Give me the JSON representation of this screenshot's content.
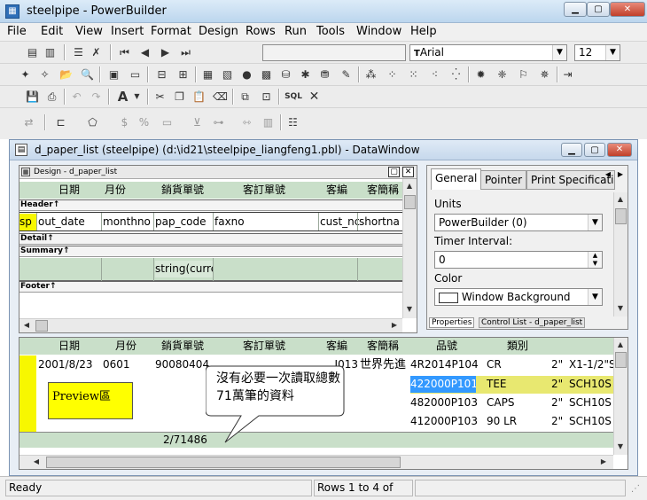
{
  "app": {
    "title": "steelpipe - PowerBuilder",
    "icon": "powerbuilder-app-icon"
  },
  "menu": [
    "File",
    "Edit",
    "View",
    "Insert",
    "Format",
    "Design",
    "Rows",
    "Run",
    "Tools",
    "Window",
    "Help"
  ],
  "font_toolbar": {
    "font": "Arial",
    "size": "12"
  },
  "window": {
    "title": "d_paper_list  (steelpipe) (d:\\id21\\steelpipe_liangfeng1.pbl) - DataWindow"
  },
  "design": {
    "title": "Design - d_paper_list",
    "headers": [
      "日期",
      "月份",
      "銷貨單號",
      "客訂單號",
      "客編",
      "客簡稱"
    ],
    "bands": {
      "header": "Header↑",
      "detail": "Detail↑",
      "summary": "Summary↑",
      "footer": "Footer↑"
    },
    "detail_fields": [
      "sp",
      "out_date",
      "monthno",
      "pap_code",
      "faxno",
      "cust_nc",
      "shortna"
    ],
    "summary_field": "string(curre"
  },
  "properties": {
    "tabs": [
      "General",
      "Pointer",
      "Print Specificatio"
    ],
    "units_label": "Units",
    "units_value": "PowerBuilder (0)",
    "timer_label": "Timer Interval:",
    "timer_value": "0",
    "color_label": "Color",
    "color_value": "Window Background",
    "bottom_tabs": [
      "Properties",
      "Control List - d_paper_list"
    ]
  },
  "preview": {
    "headers": [
      "日期",
      "月份",
      "銷貨單號",
      "客訂單號",
      "客編",
      "客簡稱",
      "品號",
      "類別"
    ],
    "rows": [
      {
        "date": "2001/8/23",
        "month": "0601",
        "sale_no": "90080404",
        "cust_code": "J013",
        "short": "世界先進",
        "item": "4R2014P104",
        "cat": "CR",
        "size": "2\"",
        "spec": "X1-1/2\"S"
      },
      {
        "item": "422000P101",
        "cat": "TEE",
        "size": "2\"",
        "spec": "SCH10S"
      },
      {
        "item": "482000P103",
        "cat": "CAPS",
        "size": "2\"",
        "spec": "SCH10S"
      },
      {
        "item": "412000P103",
        "cat": "90 LR",
        "size": "2\"",
        "spec": "SCH10S"
      }
    ],
    "preview_label": "Preview區",
    "callout": "沒有必要一次讀取總數71萬筆的資料",
    "summary_value": "2/71486"
  },
  "status": {
    "ready": "Ready",
    "rows": "Rows 1 to 4 of"
  },
  "colors": {
    "header_green": "#c9dfc9",
    "highlight_yellow": "#f7f700",
    "selected_blue": "#3399ff",
    "row_yellow": "#e8e870"
  }
}
